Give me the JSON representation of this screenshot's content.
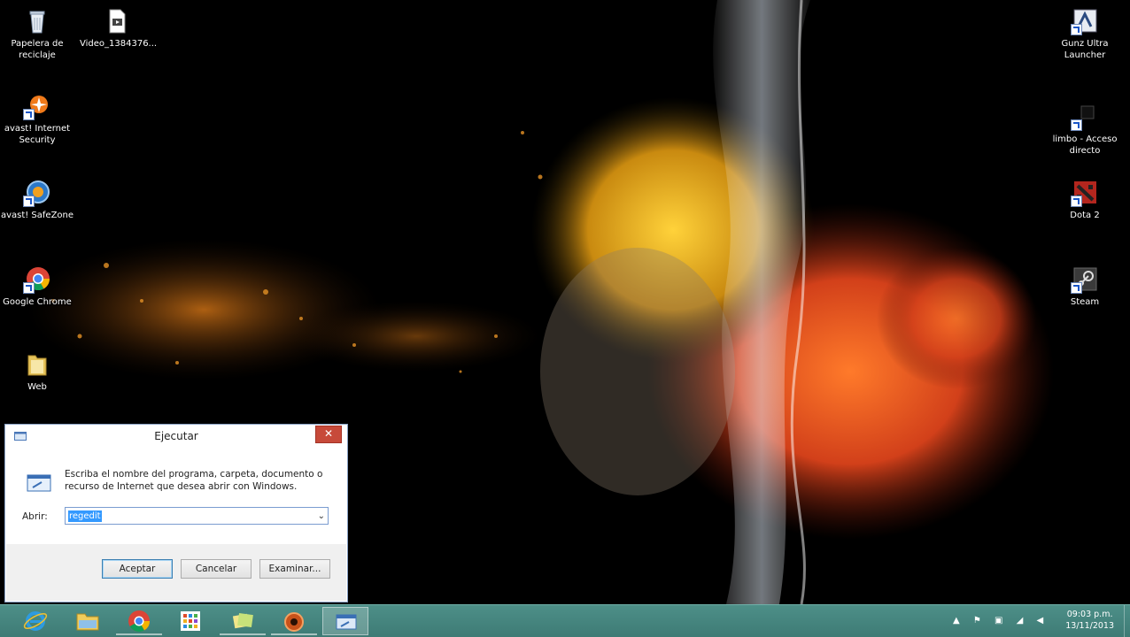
{
  "desktop": {
    "left_icons": [
      {
        "label": "Papelera de reciclaje",
        "icon": "recycle-bin-icon"
      },
      {
        "label": "Video_1384376...",
        "icon": "video-file-icon"
      },
      {
        "label": "avast! Internet Security",
        "icon": "avast-icon"
      },
      {
        "label": "avast! SafeZone",
        "icon": "avast-safezone-icon"
      },
      {
        "label": "Google Chrome",
        "icon": "chrome-icon"
      },
      {
        "label": "Web",
        "icon": "folder-icon"
      }
    ],
    "right_icons": [
      {
        "label": "Gunz Ultra Launcher",
        "icon": "gunz-launcher-icon"
      },
      {
        "label": "limbo - Acceso directo",
        "icon": "limbo-icon"
      },
      {
        "label": "Dota 2",
        "icon": "dota2-icon"
      },
      {
        "label": "Steam",
        "icon": "steam-icon"
      }
    ]
  },
  "run_dialog": {
    "title": "Ejecutar",
    "close_symbol": "✕",
    "description": "Escriba el nombre del programa, carpeta, documento o recurso de Internet que desea abrir con Windows.",
    "abrir_label": "Abrir:",
    "input_value": "regedit",
    "dropdown_symbol": "⌄",
    "buttons": {
      "ok": "Aceptar",
      "cancel": "Cancelar",
      "browse": "Examinar..."
    }
  },
  "taskbar": {
    "apps": [
      {
        "name": "internet-explorer-icon",
        "state": "pinned"
      },
      {
        "name": "file-explorer-icon",
        "state": "pinned"
      },
      {
        "name": "chrome-icon",
        "state": "open"
      },
      {
        "name": "apps-grid-icon",
        "state": "pinned"
      },
      {
        "name": "sticky-notes-icon",
        "state": "open"
      },
      {
        "name": "media-app-icon",
        "state": "open"
      },
      {
        "name": "run-window-icon",
        "state": "active"
      }
    ],
    "tray_icons": [
      "chevron-up-icon",
      "flag-icon",
      "network-icon",
      "signal-icon",
      "volume-icon"
    ],
    "tray_glyphs": "▲ ⚑ ▣ ◢ ◀",
    "clock": {
      "time": "09:03 p.m.",
      "date": "13/11/2013"
    }
  },
  "colors": {
    "taskbar": "#3e7b75",
    "close_button": "#c74a3a",
    "selection": "#3399ff"
  }
}
